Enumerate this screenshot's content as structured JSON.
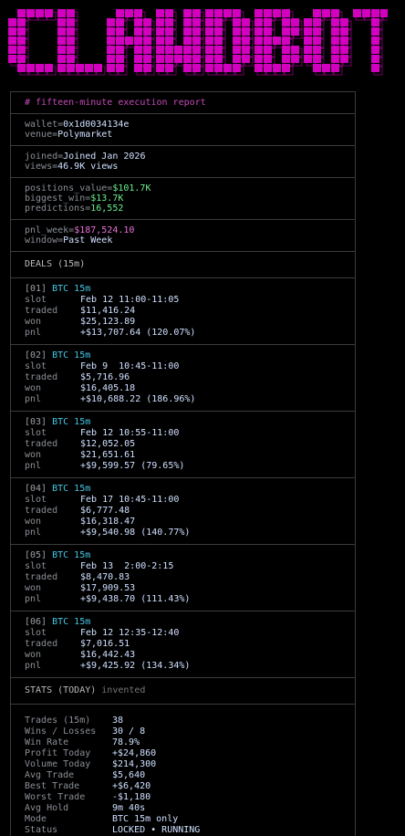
{
  "logo": {
    "text": "CLAWDBOT",
    "color": "#d300c0"
  },
  "report_header": "# fifteen-minute execution report",
  "account": {
    "wallet_key": "wallet=",
    "wallet": "0x1d0034134e",
    "venue_key": "venue=",
    "venue": "Polymarket"
  },
  "profile": {
    "joined_key": "joined=",
    "joined": "Joined Jan 2026",
    "views_key": "views=",
    "views": "46.9K views"
  },
  "portfolio": {
    "positions_key": "positions_value=",
    "positions": "$101.7K",
    "biggest_key": "biggest_win=",
    "biggest": "$13.7K",
    "predictions_key": "predictions=",
    "predictions": "16,552"
  },
  "pnl": {
    "week_key": "pnl_week=",
    "week": "$187,524.10",
    "window_key": "window=",
    "window": "Past Week"
  },
  "deals_header": "DEALS (15m)",
  "deal_labels": {
    "slot": "slot",
    "traded": "traded",
    "won": "won",
    "pnl": "pnl"
  },
  "deals": [
    {
      "idx": "[01]",
      "market": "BTC 15m",
      "slot": "Feb 12 11:00-11:05",
      "traded": "$11,416.24",
      "won": "$25,123.89",
      "pnl": "+$13,707.64 (120.07%)"
    },
    {
      "idx": "[02]",
      "market": "BTC 15m",
      "slot": "Feb 9  10:45-11:00",
      "traded": "$5,716.96",
      "won": "$16,405.18",
      "pnl": "+$10,688.22 (186.96%)"
    },
    {
      "idx": "[03]",
      "market": "BTC 15m",
      "slot": "Feb 12 10:55-11:00",
      "traded": "$12,052.05",
      "won": "$21,651.61",
      "pnl": "+$9,599.57 (79.65%)"
    },
    {
      "idx": "[04]",
      "market": "BTC 15m",
      "slot": "Feb 17 10:45-11:00",
      "traded": "$6,777.48",
      "won": "$16,318.47",
      "pnl": "+$9,540.98 (140.77%)"
    },
    {
      "idx": "[05]",
      "market": "BTC 15m",
      "slot": "Feb 13  2:00-2:15",
      "traded": "$8,470.83",
      "won": "$17,909.53",
      "pnl": "+$9,438.70 (111.43%)"
    },
    {
      "idx": "[06]",
      "market": "BTC 15m",
      "slot": "Feb 12 12:35-12:40",
      "traded": "$7,016.51",
      "won": "$16,442.43",
      "pnl": "+$9,425.92 (134.34%)"
    }
  ],
  "stats_header": "STATS (TODAY)",
  "stats_subheader": "invented",
  "stats": [
    {
      "label": "Trades (15m)",
      "value": "38",
      "tone": "v"
    },
    {
      "label": "Wins / Losses",
      "value": "30 / 8",
      "tone": "v"
    },
    {
      "label": "Win Rate",
      "value": "78.9%",
      "tone": "v"
    },
    {
      "label": "Profit Today",
      "value": "+$24,860",
      "tone": "pink"
    },
    {
      "label": "Volume Today",
      "value": "$214,300",
      "tone": "v"
    },
    {
      "label": "Avg Trade",
      "value": "$5,640",
      "tone": "v"
    },
    {
      "label": "Best Trade",
      "value": "+$6,420",
      "tone": "pink"
    },
    {
      "label": "Worst Trade",
      "value": "-$1,180",
      "tone": "orange"
    },
    {
      "label": "Avg Hold",
      "value": "9m 40s",
      "tone": "v"
    },
    {
      "label": "Mode",
      "value": "BTC 15m only",
      "tone": "v"
    },
    {
      "label": "Status",
      "value": "LOCKED • RUNNING",
      "tone": "green"
    }
  ]
}
